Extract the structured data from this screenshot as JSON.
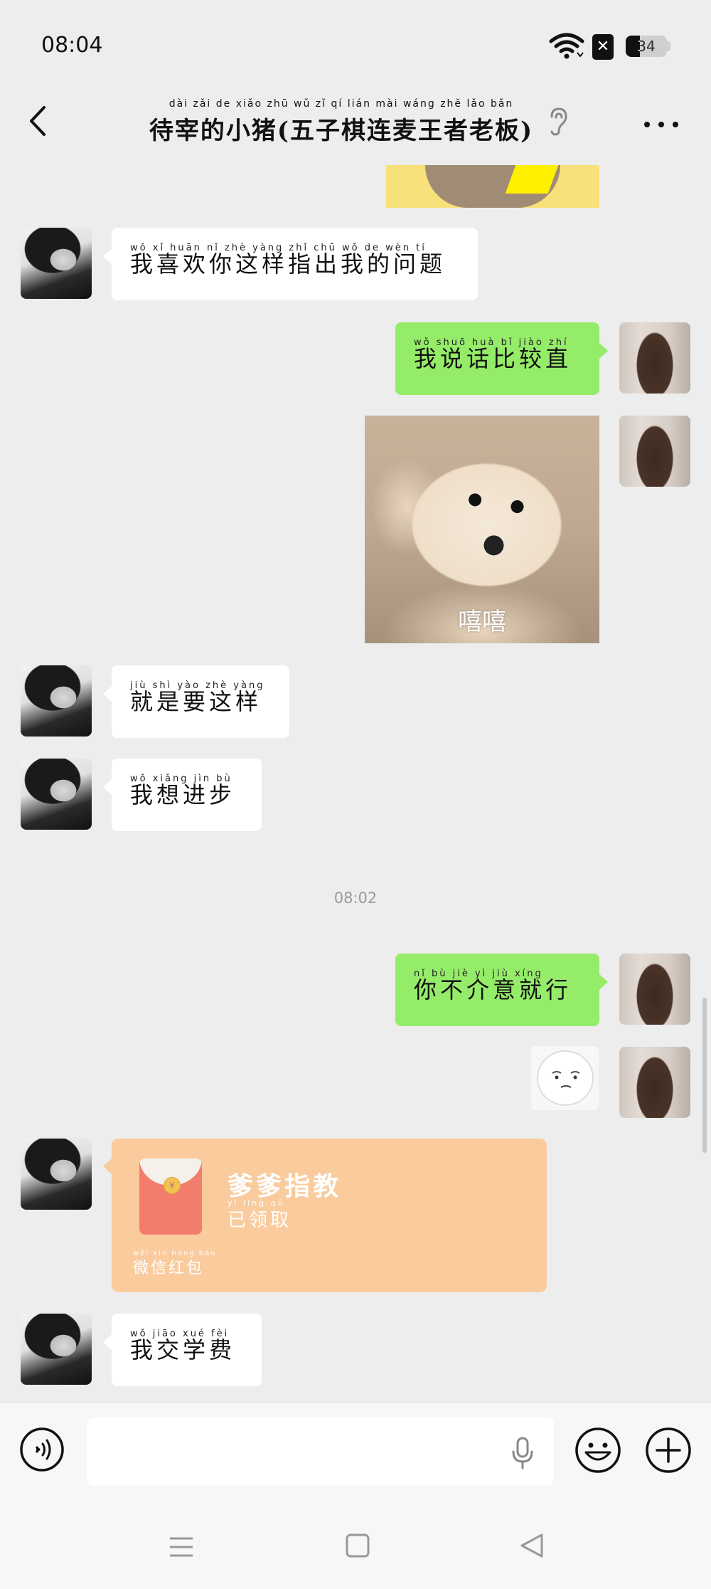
{
  "status_bar": {
    "time": "08:04",
    "battery_level": "34",
    "icons": [
      "wifi-icon",
      "sim-off-icon",
      "battery-icon"
    ]
  },
  "header": {
    "title": "待宰的小猪(五子棋连麦王者老板)",
    "title_pinyin": "dài zǎi de xiǎo zhū   wǔ zǐ qí lián mài wáng zhě lǎo bǎn",
    "icons": [
      "back-arrow-icon",
      "ear-icon",
      "more-icon"
    ]
  },
  "messages": [
    {
      "side": "left",
      "text": "我喜欢你这样指出我的问题",
      "pinyin": "wǒ  xǐ  huān  nǐ  zhè yàng zhǐ chū wǒ  de  wèn  tí"
    },
    {
      "side": "right",
      "text": "我说话比较直",
      "pinyin": "wǒ shuō huà  bǐ  jiào zhí"
    },
    {
      "side": "right",
      "type": "image",
      "caption": "嘻嘻"
    },
    {
      "side": "left",
      "text": "就是要这样",
      "pinyin": "jiù  shì  yào  zhè yàng"
    },
    {
      "side": "left",
      "text": "我想进步",
      "pinyin": "wǒ xiǎng jìn  bù"
    },
    {
      "side": "right",
      "text": "你不介意就行",
      "pinyin": "nǐ  bù  jiè  yì  jiù  xíng"
    },
    {
      "side": "right",
      "type": "sticker"
    },
    {
      "side": "left",
      "text": "我交学费",
      "pinyin": "wǒ jiāo xué fèi"
    }
  ],
  "timestamp": "08:02",
  "red_packet": {
    "title": "爹爹指教",
    "status": "已领取",
    "status_pinyin": "yǐ lǐng qǔ",
    "label": "微信红包",
    "label_pinyin": "wēi xìn hóng bāo"
  },
  "input": {
    "value": "",
    "placeholder": ""
  },
  "colors": {
    "background": "#ededed",
    "bubble_self": "#95ec69",
    "bubble_other": "#ffffff",
    "red_packet": "#f9cb9d"
  }
}
